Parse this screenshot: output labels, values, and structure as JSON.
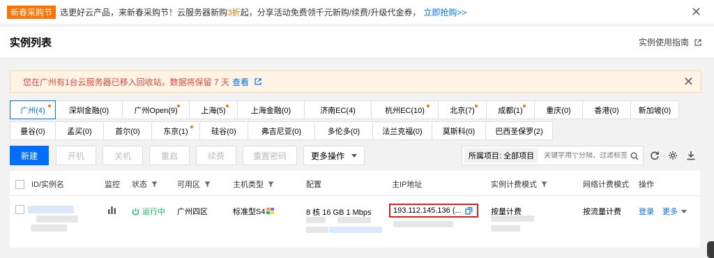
{
  "promo": {
    "tag": "新春采购节",
    "text_before": "选更好云产品，来新春采购节！云服务器新购",
    "highlight": "3折",
    "text_after": "起，分享活动免费领千元新购/续费/升级代金券，",
    "link": "立即抢购>>"
  },
  "header": {
    "title": "实例列表",
    "guide": "实例使用指南"
  },
  "notice": {
    "text": "您在广州有1台云服务器已移入回收站，数据将保留 7 天",
    "link": "查看"
  },
  "regions": {
    "row1": [
      {
        "label": "广州(4)",
        "dot": true,
        "active": true
      },
      {
        "label": "深圳金融(0)",
        "dot": false
      },
      {
        "label": "广州Open(9)",
        "dot": true
      },
      {
        "label": "上海(5)",
        "dot": true
      },
      {
        "label": "上海金融(0)",
        "dot": false
      },
      {
        "label": "济南EC(4)",
        "dot": false
      },
      {
        "label": "杭州EC(10)",
        "dot": true
      },
      {
        "label": "北京(7)",
        "dot": true
      },
      {
        "label": "成都(1)",
        "dot": true
      },
      {
        "label": "重庆(0)",
        "dot": false
      },
      {
        "label": "香港(0)",
        "dot": false
      },
      {
        "label": "新加坡(0)",
        "dot": false
      }
    ],
    "row2": [
      {
        "label": "曼谷(0)",
        "dot": false
      },
      {
        "label": "孟买(0)",
        "dot": false
      },
      {
        "label": "首尔(0)",
        "dot": false
      },
      {
        "label": "东京(1)",
        "dot": true
      },
      {
        "label": "硅谷(0)",
        "dot": false
      },
      {
        "label": "弗吉尼亚(0)",
        "dot": false
      },
      {
        "label": "多伦多(0)",
        "dot": false
      },
      {
        "label": "法兰克福(0)",
        "dot": false
      },
      {
        "label": "莫斯科(0)",
        "dot": false
      },
      {
        "label": "巴西圣保罗(2)",
        "dot": false
      }
    ]
  },
  "toolbar": {
    "new": "新建",
    "start": "开机",
    "stop": "关机",
    "restart": "重启",
    "renew": "续费",
    "reset_pwd": "重置密码",
    "more": "更多操作",
    "project": "所属项目: 全部项目",
    "search_placeholder": "关键字用\"|\"分隔，过滤标签"
  },
  "table": {
    "headers": {
      "id": "ID/实例名",
      "monitor": "监控",
      "status": "状态",
      "zone": "可用区",
      "type": "主机类型",
      "config": "配置",
      "ip": "主IP地址",
      "billing": "实例计费模式",
      "net_billing": "网络计费模式",
      "ops": "操作"
    },
    "row": {
      "status": "运行中",
      "zone": "广州四区",
      "type": "标准型S4",
      "config": "8 核 16 GB 1 Mbps",
      "ip": "193.112.145.136 (...",
      "billing": "按量计费",
      "net_billing": "按流量计费",
      "login": "登录",
      "more": "更多"
    }
  }
}
